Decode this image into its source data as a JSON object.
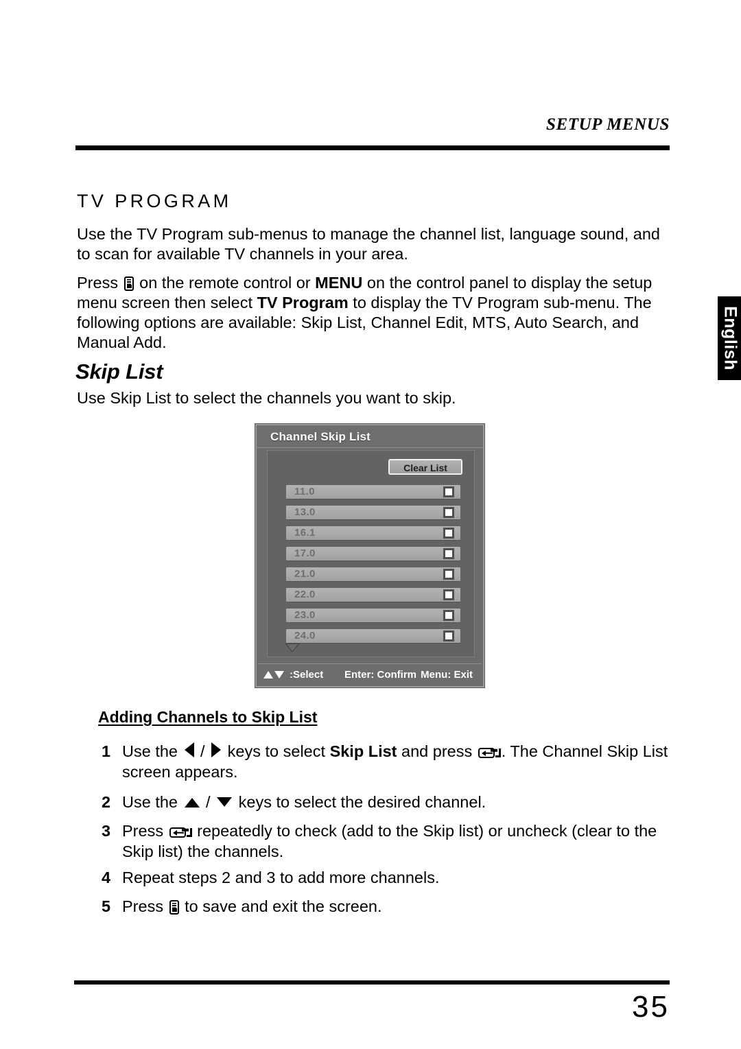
{
  "page": {
    "running_head": "SETUP MENUS",
    "number": "35",
    "language_tab": "English"
  },
  "section": {
    "title": "TV PROGRAM",
    "intro": "Use the TV Program sub-menus to manage the channel list, language sound, and to scan for available TV channels in your area.",
    "press_part_1": "Press ",
    "press_part_2": " on the remote control or ",
    "press_bold_menu": "MENU",
    "press_part_3": " on the control panel to display the setup menu screen then select ",
    "press_bold_tvprogram": "TV Program",
    "press_part_4": " to display the TV Program sub-menu. The following options are available: Skip List, Channel Edit, MTS, Auto Search, and Manual Add."
  },
  "skip_list": {
    "heading": "Skip List",
    "description": "Use Skip List to select the channels you want to skip."
  },
  "osd": {
    "title": "Channel Skip List",
    "clear_button": "Clear List",
    "channels": [
      {
        "label": "11.0",
        "checked": false
      },
      {
        "label": "13.0",
        "checked": false
      },
      {
        "label": "16.1",
        "checked": false
      },
      {
        "label": "17.0",
        "checked": false
      },
      {
        "label": "21.0",
        "checked": false
      },
      {
        "label": "22.0",
        "checked": false
      },
      {
        "label": "23.0",
        "checked": false
      },
      {
        "label": "24.0",
        "checked": false
      }
    ],
    "scroll_indicator": "down-arrow",
    "footer": {
      "select": ":Select",
      "confirm": "Enter: Confirm",
      "exit": "Menu: Exit"
    }
  },
  "procedure": {
    "heading": "Adding Channels to Skip List",
    "steps": [
      {
        "num": "1",
        "a": "Use the ",
        "b": " / ",
        "c": " keys to select ",
        "bold": "Skip List",
        "d": " and press ",
        "e": ". The Channel Skip List screen appears."
      },
      {
        "num": "2",
        "a": "Use the ",
        "b": " / ",
        "c": " keys to select the desired channel."
      },
      {
        "num": "3",
        "a": "Press ",
        "b": " repeatedly to check (add to the Skip list) or uncheck (clear to the Skip list) the channels."
      },
      {
        "num": "4",
        "a": "Repeat steps 2 and 3 to add more channels."
      },
      {
        "num": "5",
        "a": "Press ",
        "b": " to save and exit the screen."
      }
    ]
  }
}
